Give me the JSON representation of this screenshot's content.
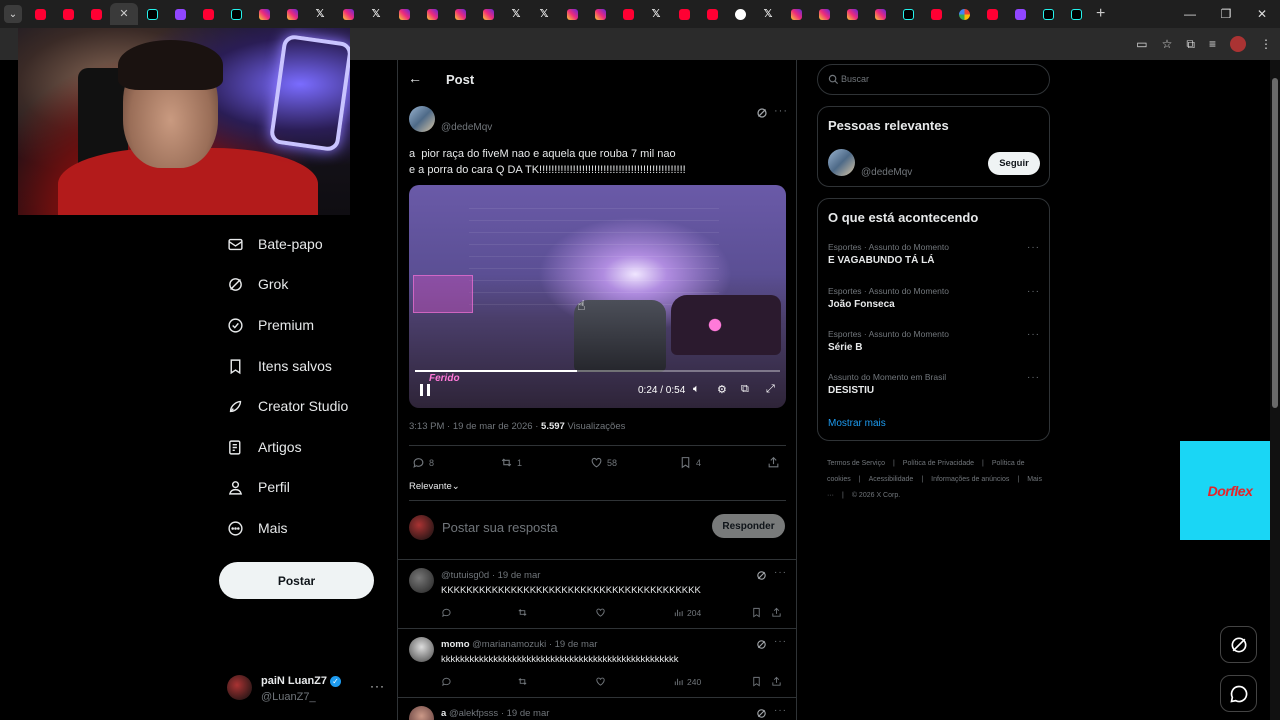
{
  "browser": {
    "tab_favicons": [
      "yt",
      "yt",
      "yt",
      "x-close",
      "tt",
      "tw",
      "yt",
      "tt",
      "ig",
      "ig",
      "x",
      "ig",
      "x",
      "ig",
      "ig",
      "ig",
      "ig",
      "x",
      "x",
      "ig",
      "ig",
      "yt",
      "x",
      "yt",
      "yt",
      "th",
      "x",
      "ig",
      "ig",
      "ig",
      "ig",
      "tt",
      "yt",
      "gl",
      "yt",
      "tw",
      "tt",
      "tt"
    ],
    "active_tab_index": 3,
    "new_tab_label": "+",
    "window_controls": {
      "minimize": "—",
      "restore": "❐",
      "close": "✕"
    }
  },
  "nav": {
    "items": [
      {
        "label": "Bate-papo",
        "icon": "mail-icon"
      },
      {
        "label": "Grok",
        "icon": "grok-icon"
      },
      {
        "label": "Premium",
        "icon": "premium-icon"
      },
      {
        "label": "Itens salvos",
        "icon": "bookmark-icon"
      },
      {
        "label": "Creator Studio",
        "icon": "rocket-icon"
      },
      {
        "label": "Artigos",
        "icon": "article-icon"
      },
      {
        "label": "Perfil",
        "icon": "person-icon"
      },
      {
        "label": "Mais",
        "icon": "more-circle-icon"
      }
    ],
    "post_button": "Postar",
    "account": {
      "name": "paiN LuanZ7",
      "handle": "@LuanZ7_",
      "more": "···"
    }
  },
  "post": {
    "header_title": "Post",
    "handle": "@dedeMqv",
    "text": "a  pior raça do fiveM nao e aquela que rouba 7 mil nao\ne a porra do cara Q DA TK!!!!!!!!!!!!!!!!!!!!!!!!!!!!!!!!!!!!!!!!!!!!!!!!",
    "video": {
      "time": "0:24 / 0:54",
      "progress": 0.444,
      "overlay_text": "Ferido"
    },
    "meta": {
      "time_date": "3:13 PM · 19 de mar de 2026 · ",
      "views": "5.597",
      "views_label": " Visualizações"
    },
    "actions": {
      "replies": "8",
      "reposts": "1",
      "likes": "58",
      "bookmarks": "4"
    },
    "sort_label": "Relevante",
    "reply_placeholder": "Postar sua resposta",
    "reply_button": "Responder"
  },
  "comments": [
    {
      "name": "",
      "handle": "@tutuisg0d",
      "date": " · 19 de mar",
      "text": "KKKKKKKKKKKKKKKKKKKKKKKKKKKKKKKKKKKKKKKKK",
      "views": "204"
    },
    {
      "name": "momo",
      "handle": "@marianamozuki",
      "date": " · 19 de mar",
      "text": "kkkkkkkkkkkkkkkkkkkkkkkkkkkkkkkkkkkkkkkkkkkkkkkkkk",
      "views": "240"
    },
    {
      "name": "a",
      "handle": "@alekfpsss",
      "date": " · 19 de mar",
      "text": "",
      "views": ""
    }
  ],
  "right": {
    "search_placeholder": "Buscar",
    "relevant": {
      "title": "Pessoas relevantes",
      "handle": "@dedeMqv",
      "follow": "Seguir"
    },
    "trends": {
      "title": "O que está acontecendo",
      "items": [
        {
          "context": "Esportes · Assunto do Momento",
          "title": "E VAGABUNDO TÁ LÁ"
        },
        {
          "context": "Esportes · Assunto do Momento",
          "title": "João Fonseca"
        },
        {
          "context": "Esportes · Assunto do Momento",
          "title": "Série B"
        },
        {
          "context": "Assunto do Momento em Brasil",
          "title": "DESISTIU"
        }
      ],
      "show_more": "Mostrar mais"
    },
    "footer": [
      "Termos de Serviço",
      "|",
      "Política de Privacidade",
      "|",
      "Política de cookies",
      "|",
      "Acessibilidade",
      "|",
      "Informações de anúncios",
      "|",
      "Mais ···",
      "|",
      "© 2026 X Corp."
    ]
  },
  "ad": {
    "brand": "Dorflex",
    "bg_color": "#1ad6f5",
    "text_color": "#e4242a"
  }
}
